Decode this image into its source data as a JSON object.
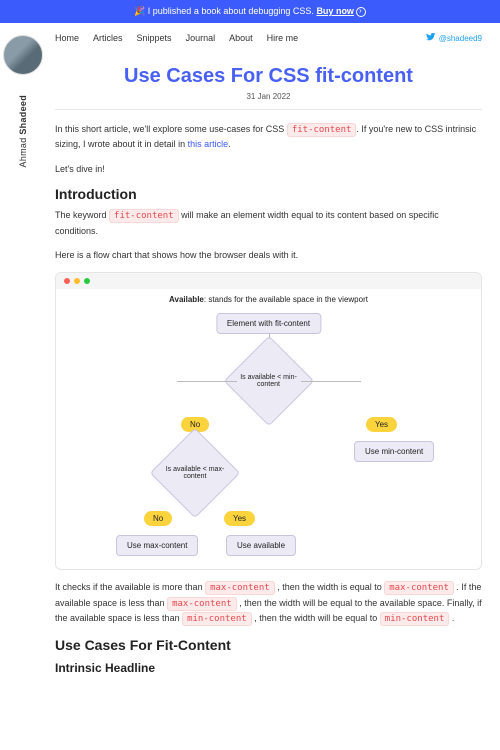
{
  "banner": {
    "emoji": "🎉",
    "text": "I published a book about debugging CSS.",
    "cta": "Buy now"
  },
  "author": {
    "first": "Ahmad",
    "last": "Shadeed",
    "twitter": "@shadeed9"
  },
  "nav": {
    "home": "Home",
    "articles": "Articles",
    "snippets": "Snippets",
    "journal": "Journal",
    "about": "About",
    "hire": "Hire me"
  },
  "article": {
    "title": "Use Cases For CSS fit-content",
    "date": "31 Jan 2022",
    "intro1a": "In this short article, we'll explore some use-cases for CSS ",
    "intro1b": ". If you're new to CSS intrinsic sizing, I wrote about it in detail in ",
    "intro1_link": "this article",
    "intro2": "Let's dive in!",
    "h_introduction": "Introduction",
    "intro3a": "The keyword ",
    "intro3b": " will make an element width equal to its content based on specific conditions.",
    "intro4": "Here is a flow chart that shows how the browser deals with it.",
    "check_a": "It checks if the available is more than ",
    "check_b": " , then the width is equal to ",
    "check_c": " . If the available space is less than ",
    "check_d": " , then the width will be equal to the available space. Finally, if the available space is less than ",
    "check_e": " , then the width will be equal to ",
    "h_usecases": "Use Cases For Fit-Content",
    "h_intrinsic": "Intrinsic Headline"
  },
  "codes": {
    "fit": "fit-content",
    "max": "max-content",
    "min": "min-content"
  },
  "flowchart": {
    "caption_b": "Available",
    "caption_t": ": stands for the available space in the viewport",
    "start": "Element with fit-content",
    "q1": "Is available < min-content",
    "q2": "Is available < max-content",
    "yes": "Yes",
    "no": "No",
    "r1": "Use min-content",
    "r2": "Use available",
    "r3": "Use max-content"
  }
}
